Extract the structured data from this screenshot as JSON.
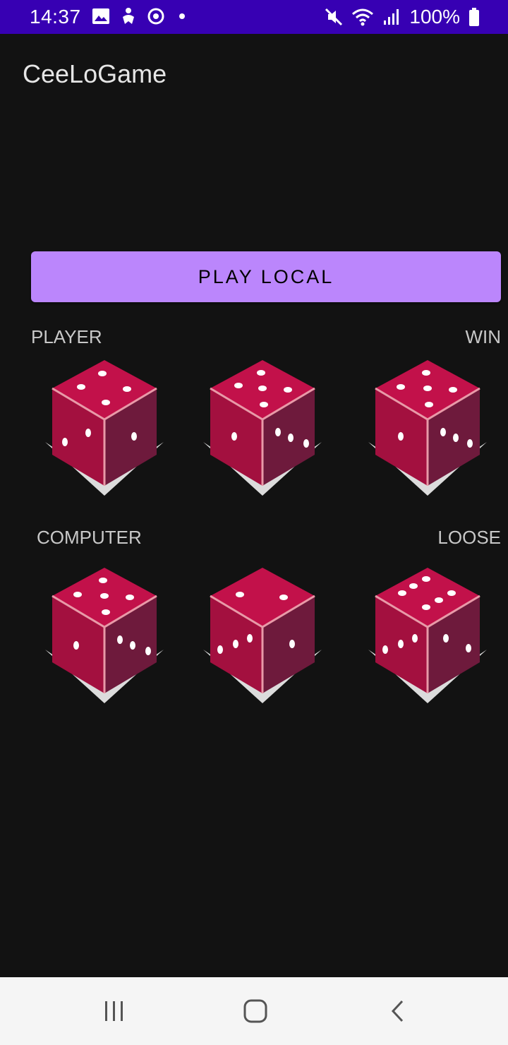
{
  "status_bar": {
    "time": "14:37",
    "battery": "100%",
    "icons_left": [
      "image-icon",
      "accessibility-icon",
      "sync-icon",
      "dot-icon"
    ],
    "icons_right": [
      "mute-icon",
      "wifi-icon",
      "signal-icon",
      "battery-icon"
    ],
    "bar_color": "#3700B3"
  },
  "app": {
    "title": "CeeLoGame"
  },
  "play_button": {
    "label": "PLAY LOCAL",
    "color": "#BB86FC"
  },
  "player": {
    "label": "PLAYER",
    "result": "WIN",
    "dice": [
      {
        "name": "player-die-1"
      },
      {
        "name": "player-die-2"
      },
      {
        "name": "player-die-3"
      }
    ]
  },
  "computer": {
    "label": "COMPUTER",
    "result": "LOOSE",
    "dice": [
      {
        "name": "computer-die-1"
      },
      {
        "name": "computer-die-2"
      },
      {
        "name": "computer-die-3"
      }
    ]
  },
  "colors": {
    "background": "#121212",
    "die_top": "#C2114A",
    "die_left": "#A3103F",
    "die_right": "#6E1A3C"
  },
  "nav_bar": {
    "icons": [
      "recents-icon",
      "home-icon",
      "back-icon"
    ]
  }
}
